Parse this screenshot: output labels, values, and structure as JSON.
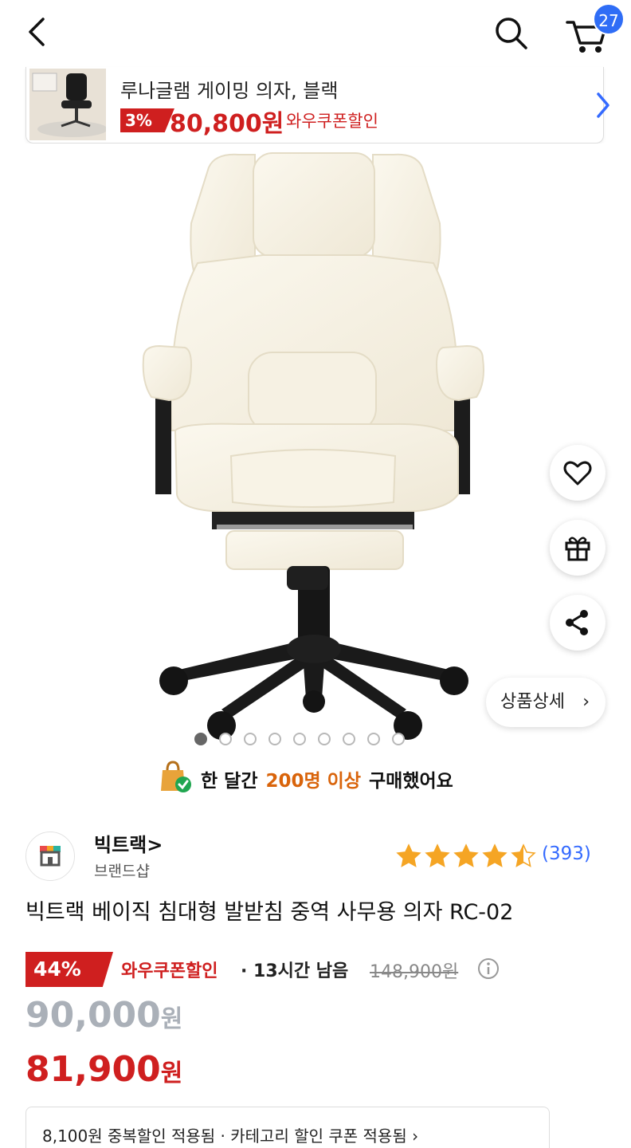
{
  "header": {
    "cart_count": "27",
    "icons": [
      "back-arrow-icon",
      "search-icon",
      "cart-icon"
    ]
  },
  "promo": {
    "title": "루나글램 게이밍 의자, 블랙",
    "discount": "3%",
    "price": "80,800원",
    "coupon": "와우쿠폰할인"
  },
  "gallery": {
    "total_images": 10,
    "active_index": 0,
    "detail_button": "상품상세",
    "detail_chevron": "›"
  },
  "buyers": {
    "prefix": "한 달간",
    "highlight": "200명 이상",
    "suffix": "구매했어요"
  },
  "seller": {
    "name": "빅트랙>",
    "type": "브랜드샵",
    "rating": 4.5,
    "review_count": "(393)"
  },
  "product": {
    "title": "빅트랙 베이직 침대형 발받침 중역 사무용 의자 RC-02"
  },
  "pricing": {
    "discount": "44%",
    "coupon": "와우쿠폰할인",
    "time_left": "· 13시간 남음",
    "original": "148,900원",
    "sale_price": "90,000",
    "coupon_price": "81,900",
    "unit": "원"
  },
  "bottom": {
    "text": "8,100원 중복할인 적용됨 · 카테고리 할인 쿠폰 적용됨 ›"
  },
  "colors": {
    "accent_red": "#cf1f1f",
    "link_blue": "#346aff",
    "badge_blue": "#2f6df6",
    "highlight_orange": "#d9640b",
    "star": "#f5a524"
  }
}
